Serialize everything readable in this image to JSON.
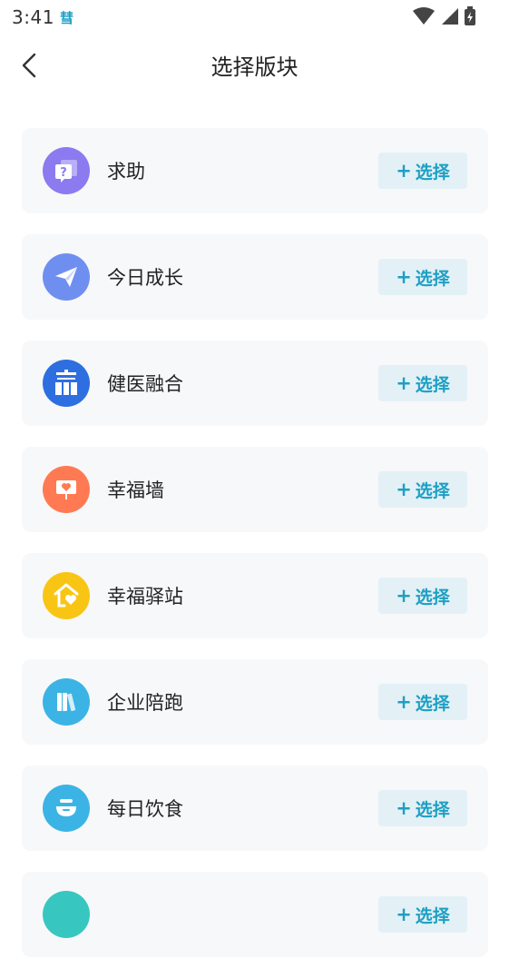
{
  "status": {
    "time": "3:41",
    "app_indicator": "彗"
  },
  "header": {
    "title": "选择版块"
  },
  "select_label": "选择",
  "colors": {
    "accent": "#1e9fc4",
    "button_bg": "#e3f1f6",
    "card_bg": "#f7f8fa"
  },
  "sections": [
    {
      "label": "求助",
      "icon": "help-question-icon",
      "color": "#8b7af0"
    },
    {
      "label": "今日成长",
      "icon": "paper-plane-icon",
      "color": "#6f8ff0"
    },
    {
      "label": "健医融合",
      "icon": "win-character-icon",
      "color": "#2d6fe0"
    },
    {
      "label": "幸福墙",
      "icon": "heart-board-icon",
      "color": "#ff7a52"
    },
    {
      "label": "幸福驿站",
      "icon": "heart-house-icon",
      "color": "#f9c515"
    },
    {
      "label": "企业陪跑",
      "icon": "books-icon",
      "color": "#3bb4e5"
    },
    {
      "label": "每日饮食",
      "icon": "food-bowl-icon",
      "color": "#3bb4e5"
    },
    {
      "label": "",
      "icon": "partial-icon",
      "color": "#38c7c0"
    }
  ]
}
